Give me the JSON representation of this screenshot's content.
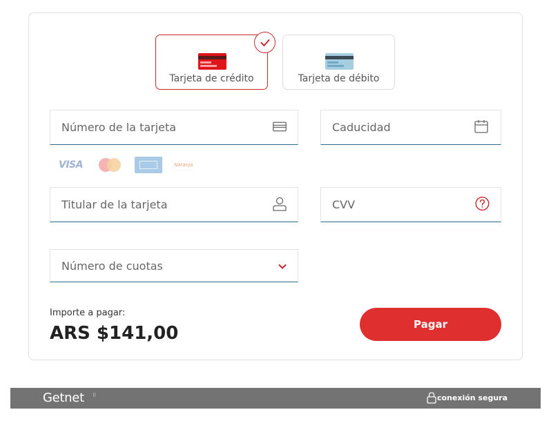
{
  "payment_methods": [
    {
      "label": "Tarjeta de crédito",
      "selected": true
    },
    {
      "label": "Tarjeta de débito",
      "selected": false
    }
  ],
  "fields": {
    "card_number": {
      "placeholder": "Número de la tarjeta",
      "icon": "card-icon"
    },
    "expiry": {
      "placeholder": "Caducidad",
      "icon": "calendar-icon"
    },
    "holder": {
      "placeholder": "Titular de la tarjeta",
      "icon": "user-icon"
    },
    "cvv": {
      "placeholder": "CVV",
      "icon": "help-icon"
    },
    "installments": {
      "placeholder": "Número de cuotas",
      "icon": "chevron-down-icon"
    }
  },
  "card_brands": {
    "visa": "VISA",
    "naranja": "Naranja"
  },
  "amount": {
    "label": "Importe a pagar:",
    "value": "ARS $141,00"
  },
  "pay_button": "Pagar",
  "footer": {
    "brand": "Getnet",
    "secure": "conexión segura"
  },
  "colors": {
    "accent": "#df2f2f",
    "field_underline": "#2b6b8a",
    "footer_bg": "#737373"
  }
}
